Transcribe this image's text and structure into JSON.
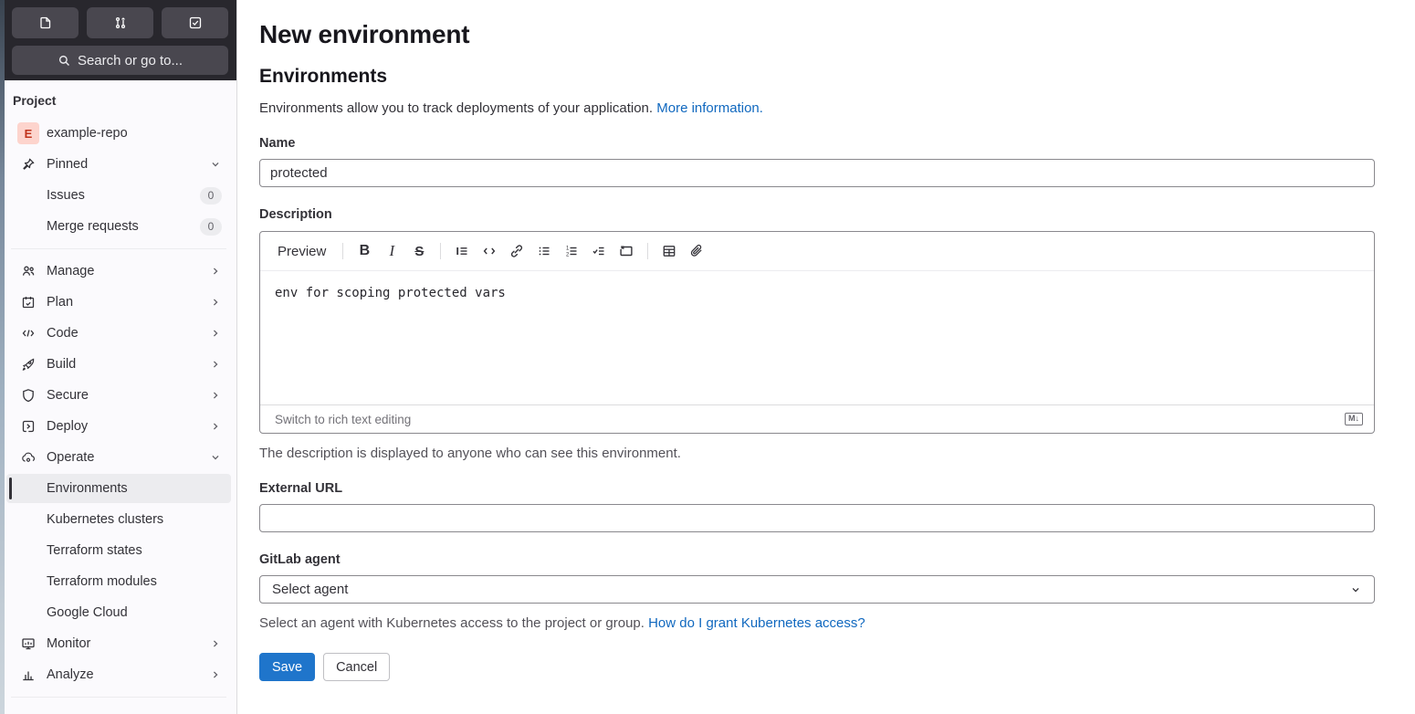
{
  "colors": {
    "accent": "#1f75cb",
    "link": "#1068bf",
    "header_bg": "#28272d",
    "sidebar_bg": "#fbfafd",
    "active_item_bg": "#ececef",
    "avatar_bg": "#fdd4cd",
    "avatar_text": "#c0341d"
  },
  "sidebar": {
    "top_buttons": [
      {
        "icon": "issues-icon"
      },
      {
        "icon": "merge-request-icon"
      },
      {
        "icon": "todo-icon"
      }
    ],
    "search": {
      "placeholder": "Search or go to...",
      "icon": "search-icon"
    },
    "section_label": "Project",
    "project": {
      "avatar_letter": "E",
      "name": "example-repo"
    },
    "pinned": {
      "label": "Pinned",
      "icon": "pin-icon",
      "chevron": "down",
      "items": [
        {
          "label": "Issues",
          "badge": "0"
        },
        {
          "label": "Merge requests",
          "badge": "0"
        }
      ]
    },
    "nav": [
      {
        "label": "Manage",
        "icon": "users-icon",
        "chevron": "right"
      },
      {
        "label": "Plan",
        "icon": "calendar-icon",
        "chevron": "right"
      },
      {
        "label": "Code",
        "icon": "code-icon",
        "chevron": "right"
      },
      {
        "label": "Build",
        "icon": "rocket-icon",
        "chevron": "right"
      },
      {
        "label": "Secure",
        "icon": "shield-icon",
        "chevron": "right"
      },
      {
        "label": "Deploy",
        "icon": "deploy-icon",
        "chevron": "right"
      },
      {
        "label": "Operate",
        "icon": "cloud-gear-icon",
        "chevron": "down"
      }
    ],
    "operate_children": [
      {
        "label": "Environments",
        "active": true
      },
      {
        "label": "Kubernetes clusters",
        "active": false
      },
      {
        "label": "Terraform states",
        "active": false
      },
      {
        "label": "Terraform modules",
        "active": false
      },
      {
        "label": "Google Cloud",
        "active": false
      }
    ],
    "nav_bottom": [
      {
        "label": "Monitor",
        "icon": "monitor-icon",
        "chevron": "right"
      },
      {
        "label": "Analyze",
        "icon": "chart-icon",
        "chevron": "right"
      }
    ]
  },
  "main": {
    "page_title": "New environment",
    "section_title": "Environments",
    "intro": {
      "text": "Environments allow you to track deployments of your application.",
      "link": "More information."
    },
    "name_field": {
      "label": "Name",
      "value": "protected"
    },
    "description": {
      "label": "Description",
      "preview_label": "Preview",
      "content": "env for scoping protected vars",
      "switch_link": "Switch to rich text editing",
      "markdown_icon_label": "M↓",
      "help": "The description is displayed to anyone who can see this environment."
    },
    "external_url": {
      "label": "External URL",
      "value": ""
    },
    "agent": {
      "label": "GitLab agent",
      "selected": "Select agent",
      "help_text": "Select an agent with Kubernetes access to the project or group.",
      "help_link": "How do I grant Kubernetes access?"
    },
    "actions": {
      "save_label": "Save",
      "cancel_label": "Cancel"
    }
  }
}
